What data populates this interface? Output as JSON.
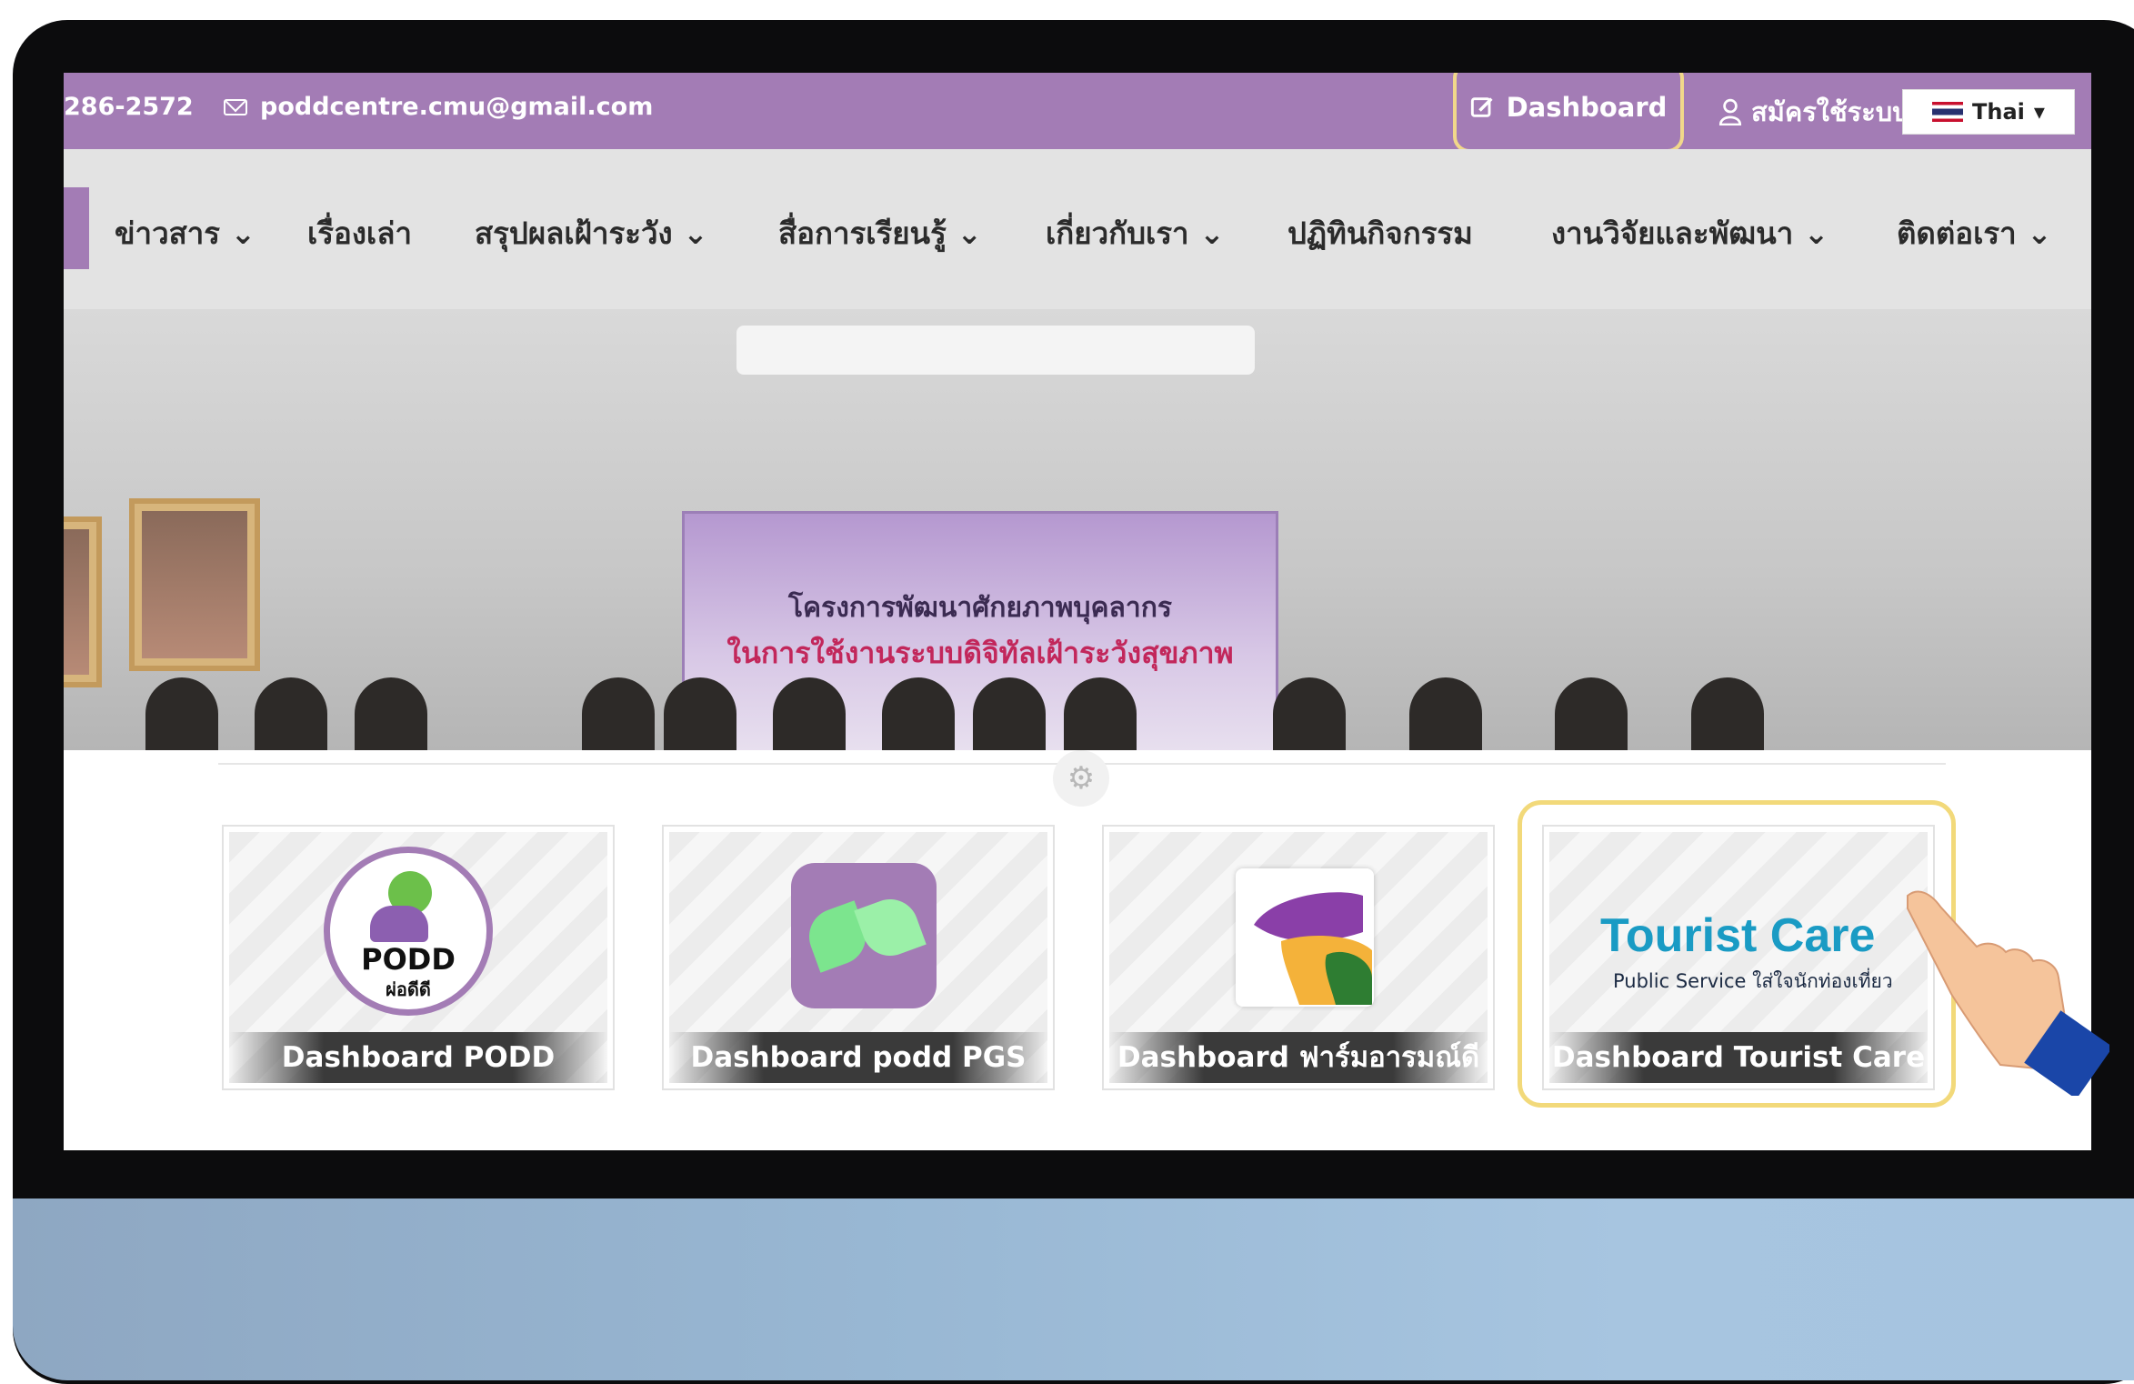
{
  "topbar": {
    "phone": "286-2572",
    "email": "poddcentre.cmu@gmail.com",
    "dashboard_label": "Dashboard",
    "register_label": "สมัครใช้ระบบ",
    "language": "Thai"
  },
  "nav": {
    "items": [
      {
        "label": "ข่าวสาร",
        "dropdown": "⌄"
      },
      {
        "label": "เรื่องเล่า",
        "dropdown": ""
      },
      {
        "label": "สรุปผลเฝ้าระวัง",
        "dropdown": "⌄"
      },
      {
        "label": "สื่อการเรียนรู้",
        "dropdown": "⌄"
      },
      {
        "label": "เกี่ยวกับเรา",
        "dropdown": "⌄"
      },
      {
        "label": "ปฏิทินกิจกรรม",
        "dropdown": ""
      },
      {
        "label": "งานวิจัยและพัฒนา",
        "dropdown": "⌄"
      },
      {
        "label": "ติดต่อเรา",
        "dropdown": "⌄"
      }
    ]
  },
  "hero": {
    "banner_line1": "โครงการพัฒนาศักยภาพบุคลากร",
    "banner_line2": "ในการใช้งานระบบดิจิทัลเฝ้าระวังสุขภาพ"
  },
  "cards": [
    {
      "label": "Dashboard PODD",
      "logo_text": "PODD",
      "logo_sub": "ผ่อดีดี"
    },
    {
      "label": "Dashboard podd PGS"
    },
    {
      "label": "Dashboard ฟาร์มอารมณ์ดี"
    },
    {
      "label": "Dashboard Tourist Care",
      "logo_title": "Tourist Care",
      "logo_sub": "Public Service ใส่ใจนักท่องเที่ยว"
    }
  ],
  "colors": {
    "brand_purple": "#a37cb5",
    "highlight": "#f2d97a"
  },
  "icons": {
    "settings": "gear-icon",
    "pointer": "hand-pointer-icon"
  }
}
